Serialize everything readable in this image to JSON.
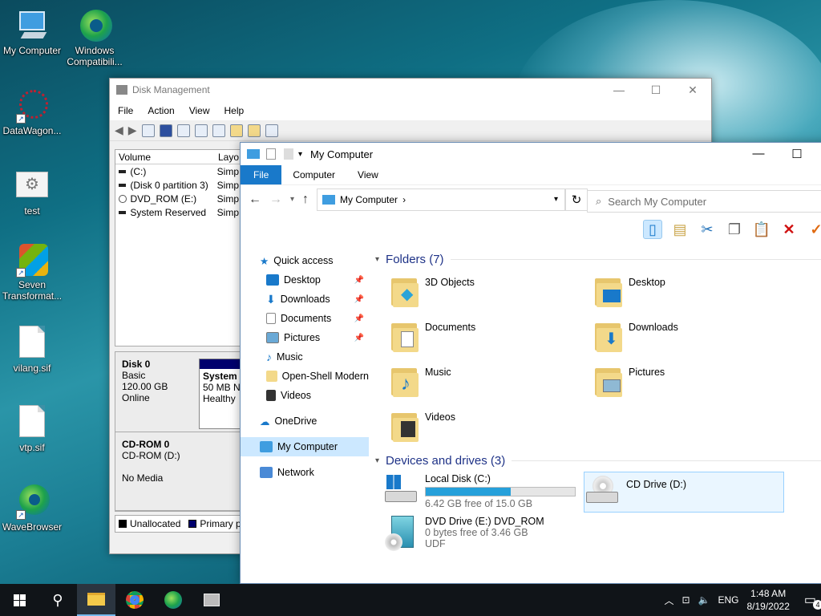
{
  "desktop": {
    "icons": [
      {
        "label": "My Computer"
      },
      {
        "label": "Windows Compatibili..."
      },
      {
        "label": "DataWagon..."
      },
      {
        "label": "test"
      },
      {
        "label": "Seven Transformat..."
      },
      {
        "label": "vilang.sif"
      },
      {
        "label": "vtp.sif"
      },
      {
        "label": "WaveBrowser"
      }
    ]
  },
  "disk_management": {
    "title": "Disk Management",
    "menu": [
      "File",
      "Action",
      "View",
      "Help"
    ],
    "col_volume": "Volume",
    "col_layout": "Layo",
    "volumes": [
      {
        "name": "(C:)",
        "layout": "Simp"
      },
      {
        "name": "(Disk 0 partition 3)",
        "layout": "Simp"
      },
      {
        "name": "DVD_ROM (E:)",
        "layout": "Simp"
      },
      {
        "name": "System Reserved",
        "layout": "Simp"
      }
    ],
    "disk0": {
      "name": "Disk 0",
      "type": "Basic",
      "size": "120.00 GB",
      "status": "Online",
      "part_title": "System",
      "part_size": "50 MB N",
      "part_health": "Healthy"
    },
    "cdrom0": {
      "name": "CD-ROM 0",
      "drive": "CD-ROM (D:)",
      "media": "No Media"
    },
    "legend": {
      "unallocated": "Unallocated",
      "primary": "Primary p"
    }
  },
  "explorer": {
    "title": "My Computer",
    "tabs": {
      "file": "File",
      "computer": "Computer",
      "view": "View"
    },
    "address": "My Computer",
    "search_placeholder": "Search My Computer",
    "nav": {
      "quick_access": "Quick access",
      "desktop": "Desktop",
      "downloads": "Downloads",
      "documents": "Documents",
      "pictures": "Pictures",
      "music": "Music",
      "open_shell": "Open-Shell Modern",
      "videos": "Videos",
      "onedrive": "OneDrive",
      "my_computer": "My Computer",
      "network": "Network"
    },
    "folders_header": "Folders (7)",
    "folders": {
      "objects3d": "3D Objects",
      "desktop": "Desktop",
      "documents": "Documents",
      "downloads": "Downloads",
      "music": "Music",
      "pictures": "Pictures",
      "videos": "Videos"
    },
    "devices_header": "Devices and drives (3)",
    "drives": {
      "c": {
        "name": "Local Disk (C:)",
        "free": "6.42 GB free of 15.0 GB",
        "used_fraction": 0.572
      },
      "d": {
        "name": "CD Drive (D:)"
      },
      "e": {
        "name": "DVD Drive (E:) DVD_ROM",
        "free": "0 bytes free of 3.46 GB",
        "fs": "UDF"
      }
    }
  },
  "taskbar": {
    "lang": "ENG",
    "time": "1:48 AM",
    "date": "8/19/2022",
    "notifications": "4"
  },
  "colors": {
    "accent": "#1979ca",
    "selection": "#cce8ff",
    "capacity": "#26a0da",
    "heading": "#1e3287"
  }
}
